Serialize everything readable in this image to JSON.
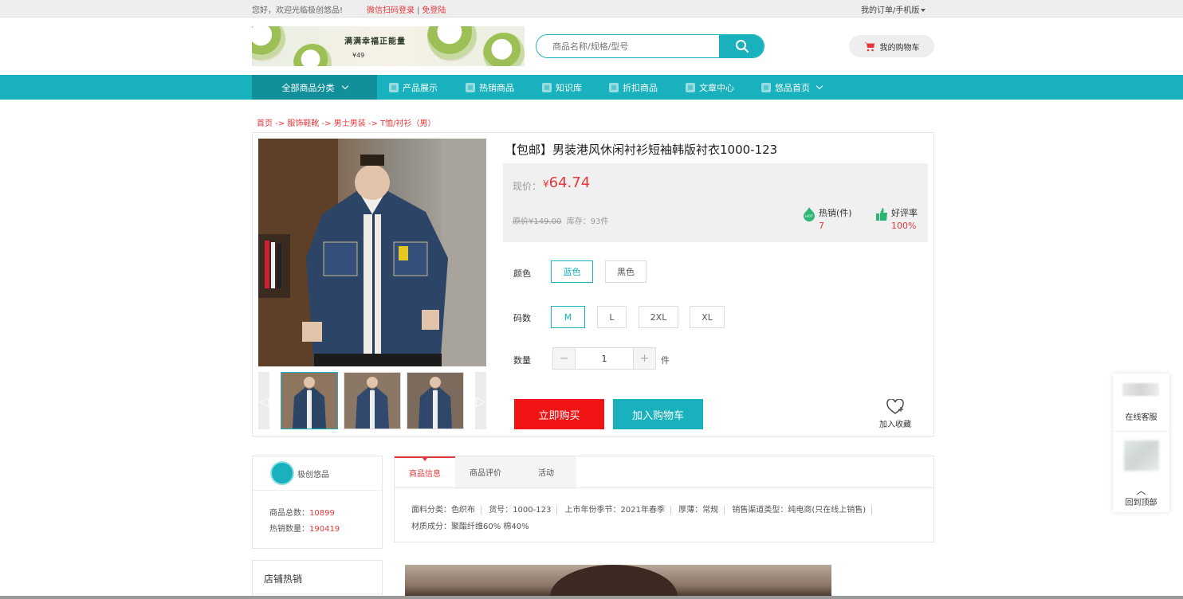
{
  "topbar": {
    "welcome": "您好，欢迎光临极创悠品!",
    "wechat_login": "微信扫码登录",
    "separator": "|",
    "register": "免登陆",
    "orders": "我的订单/手机版"
  },
  "banner": {
    "slogan": "满满幸福正能量",
    "price": "¥49"
  },
  "search": {
    "placeholder": "商品名称/规格/型号"
  },
  "cart": {
    "label": "我的购物车"
  },
  "nav": {
    "all_categories": "全部商品分类",
    "items": [
      {
        "label": "产品展示"
      },
      {
        "label": "热销商品"
      },
      {
        "label": "知识库"
      },
      {
        "label": "折扣商品"
      },
      {
        "label": "文章中心"
      },
      {
        "label": "悠品首页"
      }
    ]
  },
  "breadcrumb": "首页 -> 服饰鞋靴 -> 男士男装 -> T恤/衬衫（男）",
  "product": {
    "title": "【包邮】男装港风休闲衬衫短袖韩版衬衣1000-123",
    "price_label": "现价：",
    "price_symbol": "¥",
    "price": "64.74",
    "original_price": "原价¥149.00",
    "stock": "库存：93件",
    "hot_sales_label": "热销(件)",
    "hot_sales_value": "7",
    "rating_label": "好评率",
    "rating_value": "100%",
    "color_label": "颜色",
    "colors": [
      "蓝色",
      "黑色"
    ],
    "size_label": "码数",
    "sizes": [
      "M",
      "L",
      "2XL",
      "XL"
    ],
    "quantity_label": "数量",
    "quantity": "1",
    "quantity_minus": "−",
    "quantity_plus": "+",
    "quantity_unit": "件",
    "buy_now": "立即购买",
    "add_to_cart": "加入购物车",
    "favorite": "加入收藏",
    "thumb_prev": "◁",
    "thumb_next": "▷"
  },
  "shop": {
    "name": "极创悠品",
    "total_label": "商品总数：",
    "total_value": "10899",
    "sales_label": "热销数量：",
    "sales_value": "190419"
  },
  "tabs": {
    "items": [
      "商品信息",
      "商品评价",
      "活动"
    ],
    "active": 0,
    "attributes": [
      "面料分类：色织布",
      "货号：1000-123",
      "上市年份季节：2021年春季",
      "厚薄：常规",
      "销售渠道类型：纯电商(只在线上销售)",
      "材质成分：聚酯纤维60% 棉40%"
    ]
  },
  "hot_section": {
    "title": "店铺热销"
  },
  "float_panel": {
    "service": "在线客服",
    "up_arrow": "︿",
    "back_to_top": "回到顶部"
  },
  "colors": {
    "accent": "#18b1bd",
    "accent_dark": "#138f9a",
    "price_red": "#e4393c",
    "buy_red": "#f01414"
  }
}
